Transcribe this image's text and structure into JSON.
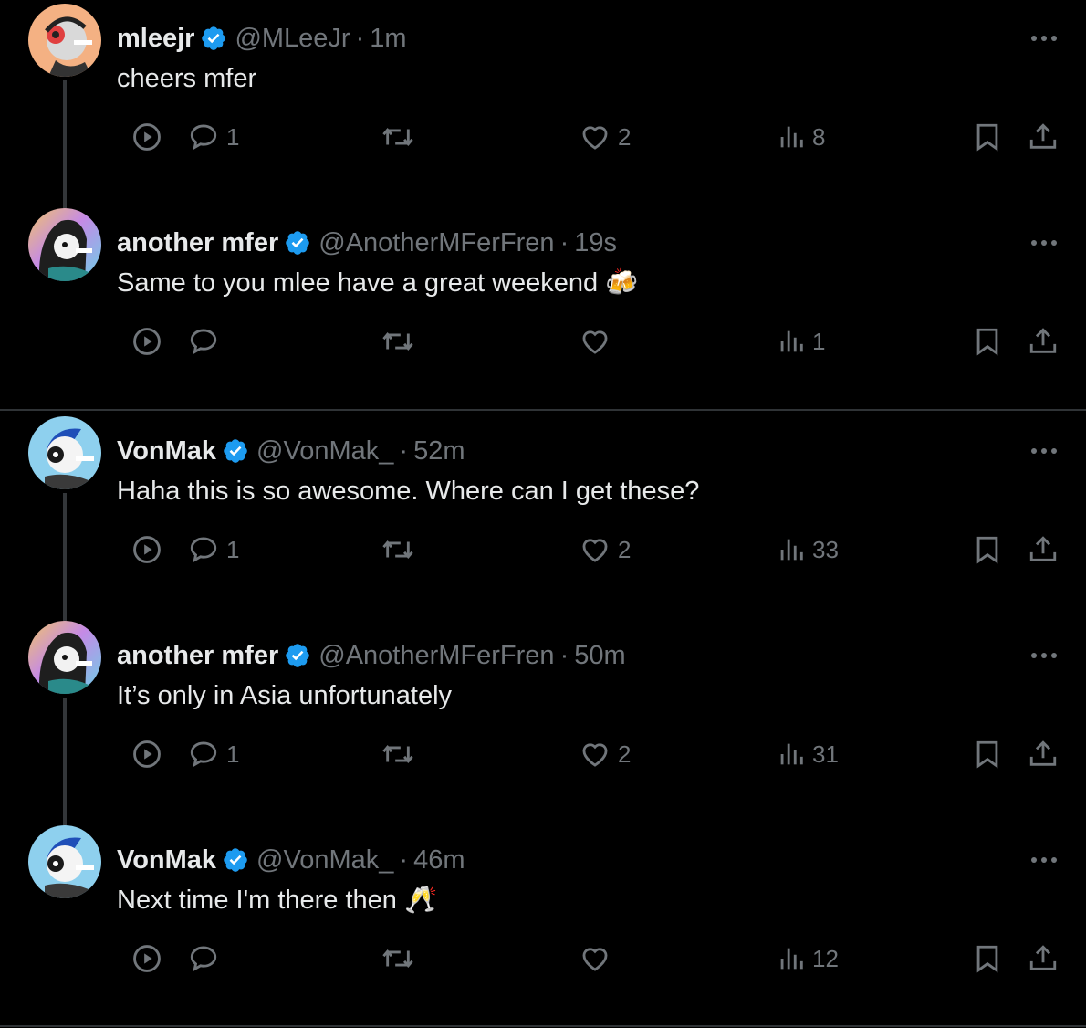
{
  "colors": {
    "background": "#000000",
    "text_primary": "#e7e9ea",
    "text_secondary": "#71767b",
    "verified_blue": "#1d9bf0",
    "divider": "#2f3336"
  },
  "icons": {
    "verified": "verified-badge-icon",
    "more": "more-options-icon",
    "video": "play-circle-icon",
    "reply": "reply-bubble-icon",
    "retweet": "retweet-icon",
    "like": "heart-icon",
    "views": "views-bar-chart-icon",
    "bookmark": "bookmark-icon",
    "share": "share-upload-icon"
  },
  "tweets": [
    {
      "name": "mleejr",
      "handle": "@MLeeJr",
      "separator": "·",
      "time": "1m",
      "text": "cheers mfer",
      "emoji": "",
      "avatar": "mleejr-avatar",
      "replies": "1",
      "retweets": "",
      "likes": "2",
      "views": "8"
    },
    {
      "name": "another mfer",
      "handle": "@AnotherMFerFren",
      "separator": "·",
      "time": "19s",
      "text": "Same to you mlee have a great weekend",
      "emoji": "🍻",
      "avatar": "another-mfer-avatar",
      "replies": "",
      "retweets": "",
      "likes": "",
      "views": "1"
    },
    {
      "name": "VonMak",
      "handle": "@VonMak_",
      "separator": "·",
      "time": "52m",
      "text": "Haha this is so awesome. Where can I get these?",
      "emoji": "",
      "avatar": "vonmak-avatar",
      "replies": "1",
      "retweets": "",
      "likes": "2",
      "views": "33"
    },
    {
      "name": "another mfer",
      "handle": "@AnotherMFerFren",
      "separator": "·",
      "time": "50m",
      "text": "It’s only in Asia unfortunately",
      "emoji": "",
      "avatar": "another-mfer-avatar",
      "replies": "1",
      "retweets": "",
      "likes": "2",
      "views": "31"
    },
    {
      "name": "VonMak",
      "handle": "@VonMak_",
      "separator": "·",
      "time": "46m",
      "text": "Next time I'm there then",
      "emoji": "🥂",
      "avatar": "vonmak-avatar",
      "replies": "",
      "retweets": "",
      "likes": "",
      "views": "12"
    }
  ]
}
